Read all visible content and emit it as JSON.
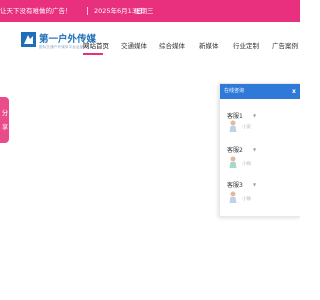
{
  "topbar": {
    "slogan": "让天下没有难做的广告！",
    "date": "2025年6月13日",
    "weekday": "星期三",
    "background": "#e8307e"
  },
  "logo": {
    "title": "第一户外传媒",
    "subtitle": "国际交通户外媒体平台运营商",
    "color": "#1f6fb8"
  },
  "nav": {
    "items": [
      "网站首页",
      "交通媒体",
      "综合媒体",
      "新媒体",
      "行业定制",
      "广告案例"
    ],
    "active_index": 0,
    "accent": "#e8307e"
  },
  "share_tab": {
    "chars": [
      "分",
      "享"
    ],
    "color": "#ea4c89"
  },
  "service_panel": {
    "title": "在线咨询",
    "close": "x",
    "header_color": "#2f79d8",
    "groups": [
      {
        "label": "客服1",
        "name": "小皮",
        "icon": "chevron-down-icon"
      },
      {
        "label": "客服2",
        "name": "小梅",
        "icon": "chevron-down-icon"
      },
      {
        "label": "客服3",
        "name": "小静",
        "icon": "chevron-down-icon"
      }
    ]
  }
}
